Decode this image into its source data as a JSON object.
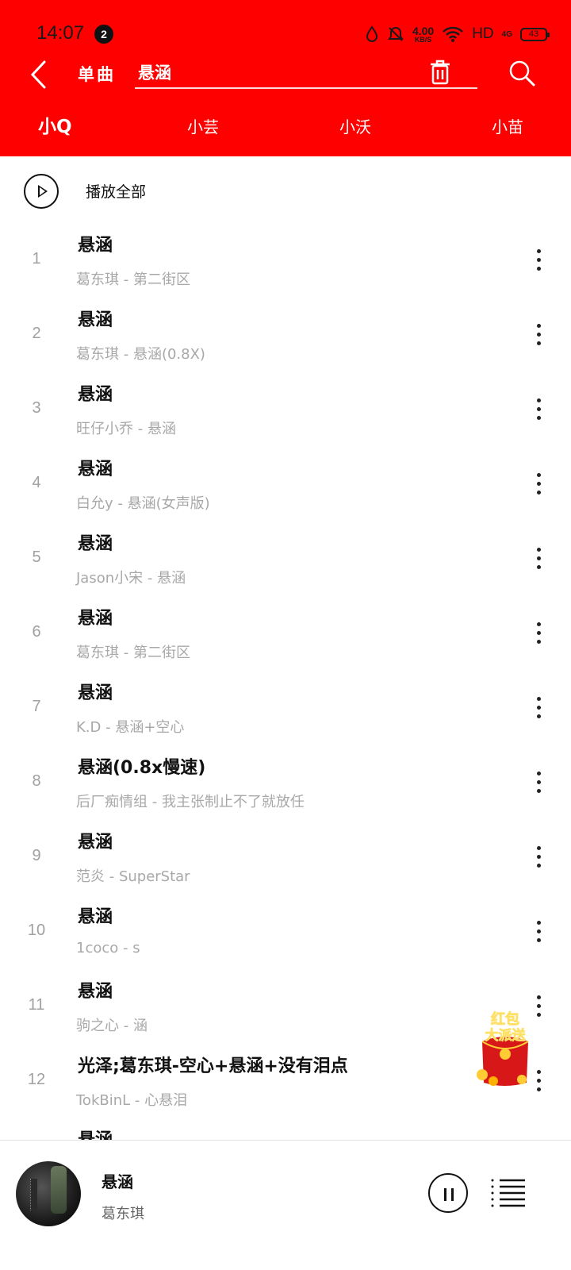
{
  "status": {
    "time": "14:07",
    "notification_count": "2",
    "speed_value": "4.00",
    "speed_unit": "KB/S",
    "hd": "HD",
    "network": "4G",
    "battery": "43"
  },
  "searchbar": {
    "type_label": "单曲",
    "query": "悬涵"
  },
  "tabs": [
    {
      "label": "小Q"
    },
    {
      "label": "小芸"
    },
    {
      "label": "小沃"
    },
    {
      "label": "小苗"
    }
  ],
  "play_all_label": "播放全部",
  "results": [
    {
      "num": "1",
      "title": "悬涵",
      "subtitle": "葛东琪 - 第二街区"
    },
    {
      "num": "2",
      "title": "悬涵",
      "subtitle": "葛东琪 - 悬涵(0.8X)"
    },
    {
      "num": "3",
      "title": "悬涵",
      "subtitle": "旺仔小乔 - 悬涵"
    },
    {
      "num": "4",
      "title": "悬涵",
      "subtitle": "白允y - 悬涵(女声版)"
    },
    {
      "num": "5",
      "title": "悬涵",
      "subtitle": "Jason小宋 - 悬涵"
    },
    {
      "num": "6",
      "title": "悬涵",
      "subtitle": "葛东琪 - 第二街区"
    },
    {
      "num": "7",
      "title": "悬涵",
      "subtitle": "K.D - 悬涵+空心"
    },
    {
      "num": "8",
      "title": "悬涵(0.8x慢速)",
      "subtitle": "后厂痴情组 - 我主张制止不了就放任"
    },
    {
      "num": "9",
      "title": "悬涵",
      "subtitle": "范炎 - SuperStar"
    },
    {
      "num": "10",
      "title": "悬涵",
      "subtitle": "1coco - s"
    },
    {
      "num": "11",
      "title": "悬涵",
      "subtitle": "驹之心 - 涵"
    },
    {
      "num": "12",
      "title": "光泽;葛东琪-空心+悬涵+没有泪点",
      "subtitle": "TokBinL - 心悬泪"
    }
  ],
  "partial_next_title": "悬涵",
  "promo": {
    "line1": "红包",
    "line2": "大派送"
  },
  "now_playing": {
    "title": "悬涵",
    "artist": "葛东琪"
  },
  "colors": {
    "header_bg": "#ff0000",
    "title_text": "#111111",
    "subtitle_text": "#a8a8a8"
  }
}
